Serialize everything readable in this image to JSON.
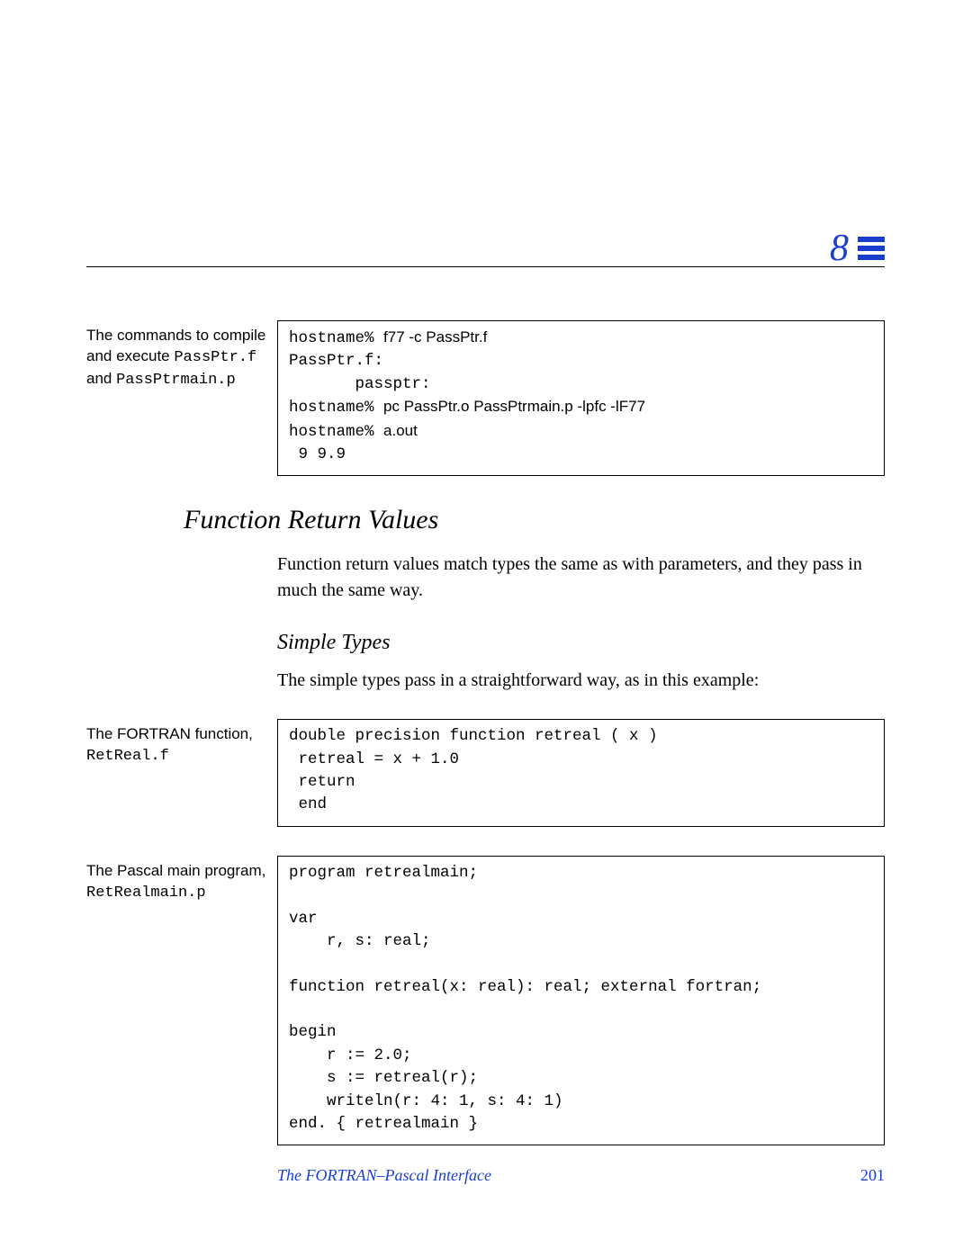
{
  "chapter_number": "8",
  "blocks": {
    "block1": {
      "sidenote_prefix": "The commands to compile and execute ",
      "sidenote_file1": "PassPtr.f",
      "sidenote_mid": " and ",
      "sidenote_file2": "PassPtrmain.p",
      "code_l1_prompt": "hostname% ",
      "code_l1_cmd": "f77 -c PassPtr.f",
      "code_l2": "PassPtr.f:",
      "code_l3": "       passptr:",
      "code_l4_prompt": "hostname% ",
      "code_l4_cmd": "pc PassPtr.o PassPtrmain.p -lpfc -lF77",
      "code_l5_prompt": "hostname% ",
      "code_l5_cmd": "a.out",
      "code_l6": " 9 9.9"
    },
    "heading1": "Function Return Values",
    "para1": "Function return values match types the same as with parameters, and they pass in much the same way.",
    "subheading1": "Simple Types",
    "para2": "The simple types pass in a straightforward way, as in this example:",
    "block2": {
      "sidenote_text": "The FORTRAN function, ",
      "sidenote_file": "RetReal.f",
      "code": "double precision function retreal ( x )\n retreal = x + 1.0\n return\n end"
    },
    "block3": {
      "sidenote_text": "The Pascal main program, ",
      "sidenote_file": "RetRealmain.p",
      "code": "program retrealmain;\n\nvar\n    r, s: real;\n\nfunction retreal(x: real): real; external fortran;\n\nbegin\n    r := 2.0;\n    s := retreal(r);\n    writeln(r: 4: 1, s: 4: 1)\nend. { retrealmain }"
    }
  },
  "footer": {
    "title": "The FORTRAN–Pascal Interface",
    "page": "201"
  }
}
